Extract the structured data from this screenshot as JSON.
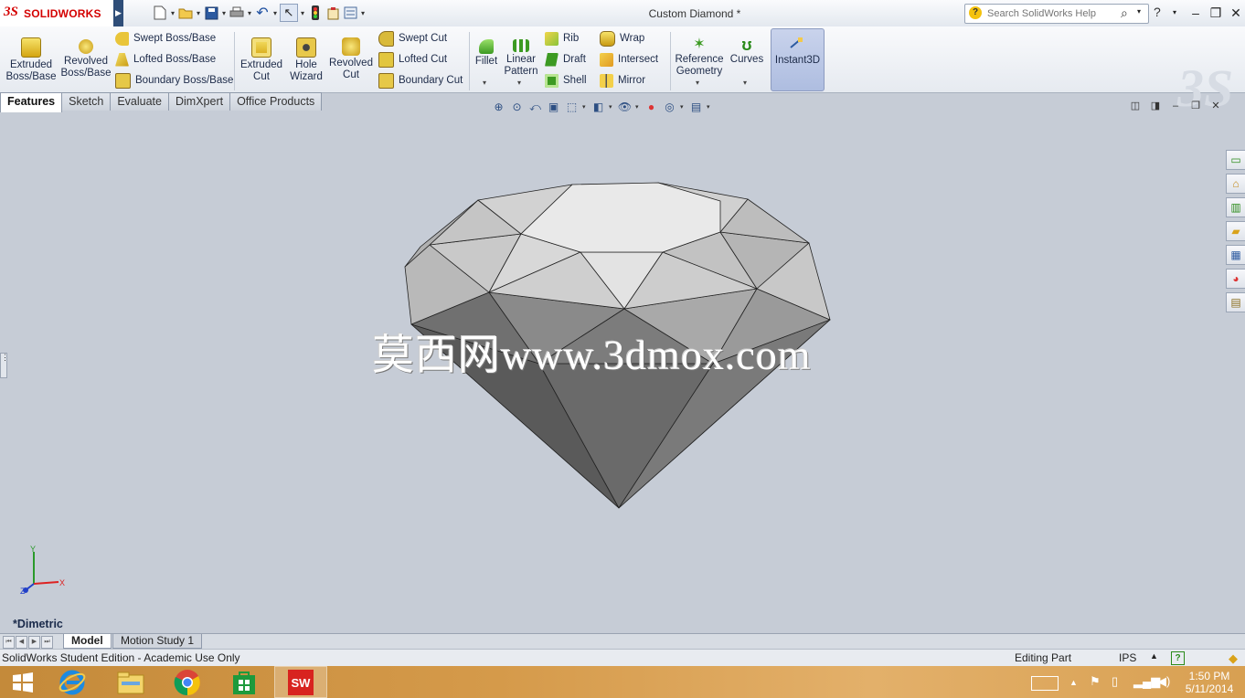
{
  "app": {
    "brand": "SOLIDWORKS",
    "brand_symbol": "3S",
    "title": "Custom Diamond *"
  },
  "colors": {
    "brand_red": "#d40000",
    "viewport_bg": "#c6ccd6",
    "taskbar": "#d59a4a",
    "ribbon_text": "#1d2b49"
  },
  "quick_access": [
    {
      "name": "new-document-icon",
      "glyph": "🗋"
    },
    {
      "name": "open-folder-icon",
      "glyph": "📂"
    },
    {
      "name": "save-icon",
      "glyph": "💾"
    },
    {
      "name": "print-icon",
      "glyph": "🖨"
    },
    {
      "name": "undo-icon",
      "glyph": "↶"
    },
    {
      "name": "select-cursor-icon",
      "glyph": "↖"
    },
    {
      "name": "rebuild-traffic-light-icon",
      "glyph": "▮"
    },
    {
      "name": "file-properties-icon",
      "glyph": "📋"
    },
    {
      "name": "options-icon",
      "glyph": "☰"
    }
  ],
  "search": {
    "placeholder": "Search SolidWorks Help",
    "help_glyph": "?"
  },
  "ribbon": {
    "extruded_boss": "Extruded\nBoss/Base",
    "revolved_boss": "Revolved\nBoss/Base",
    "swept_boss": "Swept Boss/Base",
    "lofted_boss": "Lofted Boss/Base",
    "boundary_boss": "Boundary Boss/Base",
    "extruded_cut": "Extruded\nCut",
    "hole_wizard": "Hole\nWizard",
    "revolved_cut": "Revolved\nCut",
    "swept_cut": "Swept Cut",
    "lofted_cut": "Lofted Cut",
    "boundary_cut": "Boundary Cut",
    "fillet": "Fillet",
    "linear_pattern": "Linear\nPattern",
    "rib": "Rib",
    "draft": "Draft",
    "shell": "Shell",
    "wrap": "Wrap",
    "intersect": "Intersect",
    "mirror": "Mirror",
    "reference_geometry": "Reference\nGeometry",
    "curves": "Curves",
    "instant3d": "Instant3D"
  },
  "tabs": [
    "Features",
    "Sketch",
    "Evaluate",
    "DimXpert",
    "Office Products"
  ],
  "viewport": {
    "watermark": "莫西网www.3dmox.com",
    "view_label": "*Dimetric",
    "triad": {
      "x": "X",
      "y": "Y",
      "z": "Z"
    }
  },
  "bottom_tabs": [
    "Model",
    "Motion Study 1"
  ],
  "status": {
    "edition": "SolidWorks Student Edition - Academic Use Only",
    "mode": "Editing Part",
    "units": "IPS"
  },
  "clock": {
    "time": "1:50 PM",
    "date": "5/11/2014"
  }
}
